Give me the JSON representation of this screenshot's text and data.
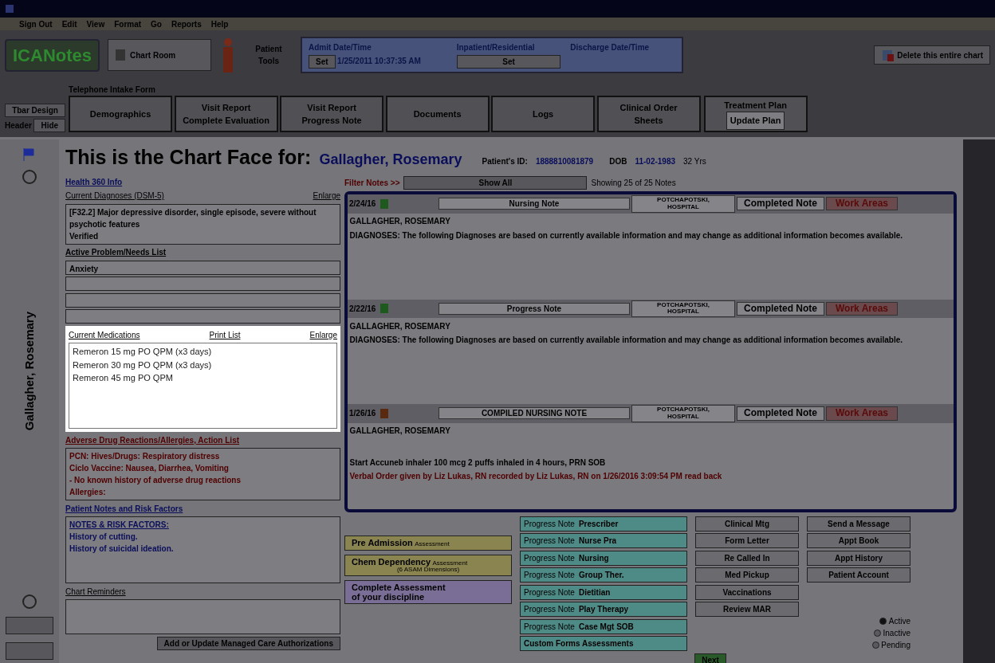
{
  "menu": [
    "Sign Out",
    "Edit",
    "View",
    "Format",
    "Go",
    "Reports",
    "Help"
  ],
  "toolbar": {
    "logo": "ICANotes",
    "chart_room": "Chart Room",
    "patient_tools": "Patient Tools",
    "admit_label": "Admit Date/Time",
    "admit_value": "1/25/2011 10:37:35 AM",
    "set_1": "Set",
    "inpatient": "Inpatient/Residential",
    "set_2": "Set",
    "discharge_label": "Discharge Date/Time",
    "delete_chart": "Delete this entire chart"
  },
  "tab_strip": {
    "tbar_design": "Tbar Design",
    "header_label": "Header",
    "hide": "Hide",
    "form_label": "Telephone Intake Form",
    "tabs": [
      {
        "label": "Demographics",
        "selected": false
      },
      {
        "label": "Visit Report\nComplete Evaluation",
        "selected": false
      },
      {
        "label": "Visit Report\nProgress Note",
        "selected": false
      },
      {
        "label": "Documents",
        "selected": false
      },
      {
        "label": "Logs",
        "selected": false
      },
      {
        "label": "Clinical Order\nSheets",
        "selected": false
      }
    ],
    "treatment_plan": {
      "label": "Treatment Plan",
      "field": "Update Plan"
    }
  },
  "patient": {
    "vertical_name": "Gallagher, Rosemary",
    "heading": "This is the Chart Face for:",
    "name": "Gallagher, Rosemary",
    "id_label": "Patient's ID:",
    "id": "1888810081879",
    "dob_label": "DOB",
    "dob": "11-02-1983",
    "age": "32 Yrs"
  },
  "left": {
    "health_link": "Health 360 Info",
    "diagnoses_title": "Current Diagnoses (DSM-5)",
    "enlarge_1": "Enlarge",
    "diagnosis": "[F32.2] Major depressive disorder, single episode, severe without psychotic features",
    "verified": "Verified",
    "problems_title": "Active Problem/Needs List",
    "problems": [
      "Anxiety"
    ],
    "meds_title": "Current Medications",
    "print_list": "Print List",
    "enlarge_2": "Enlarge",
    "medications": [
      "Remeron 15 mg PO QPM (x3 days)",
      "Remeron 30 mg PO QPM (x3 days)",
      "Remeron 45 mg PO QPM"
    ],
    "allergies_title": "Adverse Drug Reactions/Allergies, Action List",
    "allergies": [
      "PCN: Hives/Drugs: Respiratory distress",
      "Ciclo Vaccine: Nausea, Diarrhea, Vomiting",
      "- No known history of adverse drug reactions",
      "Allergies:"
    ],
    "notes_title": "Patient Notes and Risk Factors",
    "notes_heading": "NOTES & RISK FACTORS:",
    "notes": [
      "History of cutting.",
      "History of suicidal ideation."
    ],
    "reminders_title": "Chart Reminders",
    "managed_care": "Add or Update Managed Care Authorizations"
  },
  "notes_panel": {
    "filter": "Filter Notes >>",
    "show_all": "Show All",
    "showing": "Showing 25 of 25 Notes",
    "notes": [
      {
        "date": "2/24/16",
        "type": "Nursing Note",
        "author": "POTCHAPOTSKI,\nHOSPITAL",
        "status": "Completed Note",
        "work": "Work Areas",
        "lines": [
          {
            "kind": "bold",
            "text": "GALLAGHER, ROSEMARY"
          },
          {
            "kind": "bold",
            "text": "DIAGNOSES:  The following Diagnoses are based on currently available information and may change as additional information becomes available."
          }
        ]
      },
      {
        "date": "2/22/16",
        "type": "Progress Note",
        "author": "POTCHAPOTSKI,\nHOSPITAL",
        "status": "Completed Note",
        "work": "Work Areas",
        "lines": [
          {
            "kind": "bold",
            "text": "GALLAGHER, ROSEMARY"
          },
          {
            "kind": "bold",
            "text": "DIAGNOSES:  The following Diagnoses are based on currently available information and may change as additional information becomes available."
          }
        ]
      },
      {
        "date": "1/26/16",
        "type": "COMPILED NURSING NOTE",
        "author": "POTCHAPOTSKI,\nHOSPITAL",
        "status": "Completed Note",
        "work": "Work Areas",
        "lines": [
          {
            "kind": "bold",
            "text": "GALLAGHER, ROSEMARY"
          },
          {
            "kind": "spaced",
            "text": "Start Accuneb inhaler 100 mcg 2 puffs inhaled in 4 hours, PRN SOB"
          },
          {
            "kind": "red",
            "text": "Verbal Order given by Liz Lukas, RN recorded by Liz Lukas, RN on 1/26/2016 3:09:54 PM read back"
          }
        ]
      }
    ]
  },
  "assessments": [
    {
      "title": "Pre Admission",
      "sub": "Assessment",
      "color": "#8a8450"
    },
    {
      "title": "Chem Dependency",
      "sub": "Assessment",
      "note": "(6 ASAM Dimensions)",
      "color": "#8a8450"
    },
    {
      "title": "Complete Assessment\nof your discipline",
      "color": "#7a6e96"
    }
  ],
  "progress_notes": [
    {
      "prefix": "Progress Note",
      "label": "Prescriber"
    },
    {
      "prefix": "Progress Note",
      "label": "Nurse Pra"
    },
    {
      "prefix": "Progress Note",
      "label": "Nursing"
    },
    {
      "prefix": "Progress Note",
      "label": "Group Ther."
    },
    {
      "prefix": "Progress Note",
      "label": "Dietitian"
    },
    {
      "prefix": "Progress Note",
      "label": "Play Therapy"
    },
    {
      "prefix": "Progress Note",
      "label": "Case Mgt SOB"
    },
    {
      "label": "Custom Forms Assessments"
    }
  ],
  "actions_1": [
    "Clinical Mtg",
    "Form Letter",
    "Re Called In",
    "Med Pickup",
    "Vaccinations",
    "Review MAR"
  ],
  "actions_2": [
    "Send a Message",
    "Appt Book",
    "Appt History",
    "Patient Account"
  ],
  "status": [
    {
      "label": "Active",
      "selected": true
    },
    {
      "label": "Inactive",
      "selected": false
    },
    {
      "label": "Pending",
      "selected": false
    }
  ],
  "next": "Next"
}
